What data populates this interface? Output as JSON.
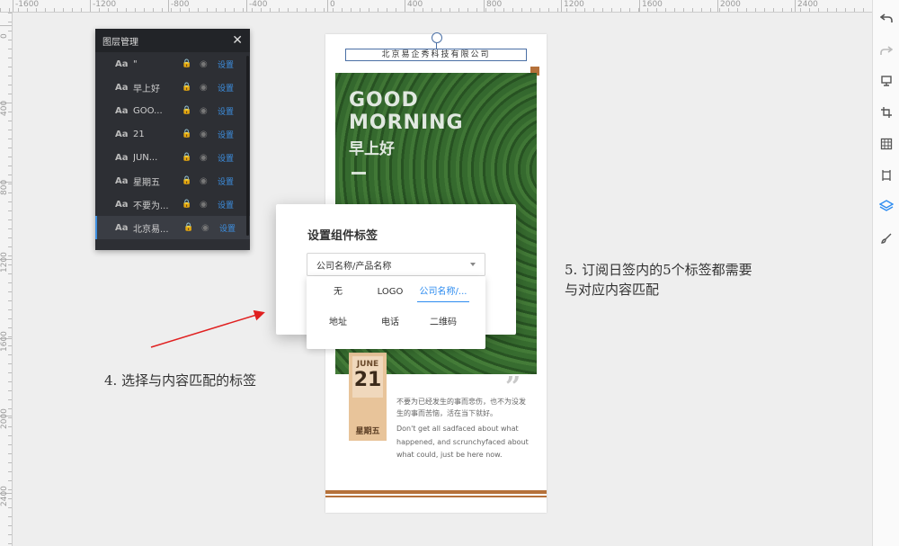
{
  "ruler": {
    "top_labels": [
      "-1600",
      "-1200",
      "-800",
      "-400",
      "0",
      "400",
      "800",
      "1200",
      "1600",
      "2000",
      "2400"
    ],
    "left_labels": [
      "0",
      "400",
      "800",
      "1200",
      "1600",
      "2000",
      "2400"
    ]
  },
  "toolbar": {
    "icons": [
      "undo-icon",
      "redo-icon",
      "display-icon",
      "crop-icon",
      "grid-icon",
      "frame-icon",
      "layers-icon",
      "brush-icon"
    ],
    "active_color": "#2d8cf0"
  },
  "layer_panel": {
    "title": "图层管理",
    "close": "✕",
    "items": [
      {
        "type": "Aa",
        "name": "\"",
        "action": "设置"
      },
      {
        "type": "Aa",
        "name": "早上好",
        "action": "设置"
      },
      {
        "type": "Aa",
        "name": "GOO...",
        "action": "设置"
      },
      {
        "type": "Aa",
        "name": "21",
        "action": "设置"
      },
      {
        "type": "Aa",
        "name": "JUN...",
        "action": "设置"
      },
      {
        "type": "Aa",
        "name": "星期五",
        "action": "设置"
      },
      {
        "type": "Aa",
        "name": "不要为...",
        "action": "设置"
      },
      {
        "type": "Aa",
        "name": "北京易...",
        "action": "设置"
      }
    ],
    "active_index": 7
  },
  "poster": {
    "company": "北京易企秀科技有限公司",
    "heading_line1": "GOOD",
    "heading_line2": "MORNING",
    "heading_cn": "早上好",
    "month": "JUNE",
    "day": "21",
    "weekday": "星期五",
    "quote_mark": "”",
    "cn_text": "不要为已经发生的事而悲伤，也不为没发生的事而苦恼，活在当下就好。",
    "en_text": "Don't get all sadfaced about what happened, and scrunchyfaced about what could, just be here now."
  },
  "modal": {
    "title": "设置组件标签",
    "selected_value": "公司名称/产品名称",
    "options": [
      "无",
      "LOGO",
      "公司名称/...",
      "地址",
      "电话",
      "二维码"
    ],
    "selected_index": 2
  },
  "annotations": {
    "step4": "4. 选择与内容匹配的标签",
    "step5_line1": "5. 订阅日签内的5个标签都需要",
    "step5_line2": "与对应内容匹配",
    "arrow_color": "#e02020"
  }
}
